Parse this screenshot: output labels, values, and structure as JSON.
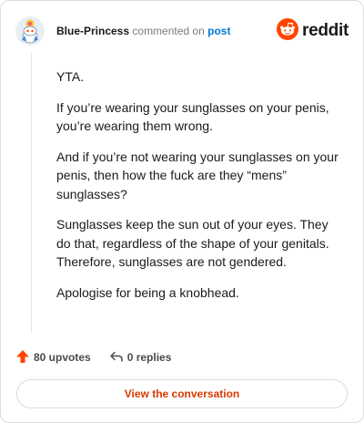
{
  "header": {
    "username": "Blue-Princess",
    "action_text": "commented on",
    "post_link_text": "post",
    "brand_name": "reddit"
  },
  "comment": {
    "paragraphs": [
      "YTA.",
      "If you’re wearing your sunglasses on your penis, you’re wearing them wrong.",
      "And if you’re not wearing your sunglasses on your penis, then how the fuck are they “mens” sunglasses?",
      "Sunglasses keep the sun out of your eyes. They do that, regardless of the shape of your genitals. Therefore, sunglasses are not gendered.",
      "Apologise for being a knobhead."
    ]
  },
  "stats": {
    "upvotes_label": "80 upvotes",
    "replies_label": "0 replies"
  },
  "cta": {
    "label": "View the conversation"
  },
  "colors": {
    "brand_orange": "#ff4500",
    "link_blue": "#0079d3",
    "cta_text": "#d93a00",
    "muted_text": "#7c7c7c"
  },
  "icons": {
    "avatar": "snoo-avatar-icon",
    "brand": "reddit-logo-icon",
    "upvote": "upvote-arrow-icon",
    "reply": "reply-arrow-icon"
  }
}
